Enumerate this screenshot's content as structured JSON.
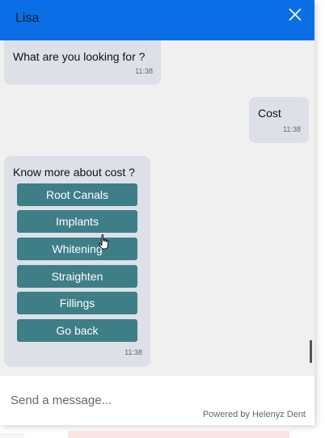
{
  "header": {
    "agent_name": "Lisa",
    "close_icon": "close-icon"
  },
  "colors": {
    "header": "#0a6fe6",
    "bubble": "#dde1e7",
    "option_button": "#3e7e87",
    "chat_bg": "#f0f0f0"
  },
  "messages": [
    {
      "from": "bot",
      "text": "What are you looking for ?",
      "time": "11:38"
    },
    {
      "from": "user",
      "text": "Cost",
      "time": "11:38"
    },
    {
      "from": "bot",
      "text": "Know more about cost ?",
      "time": "11:38",
      "options": [
        "Root Canals",
        "Implants",
        "Whitening",
        "Straighten",
        "Fillings",
        "Go back"
      ]
    }
  ],
  "composer": {
    "placeholder": "Send a message..."
  },
  "footer": {
    "powered_by": "Powered by Helenyz Dent"
  }
}
